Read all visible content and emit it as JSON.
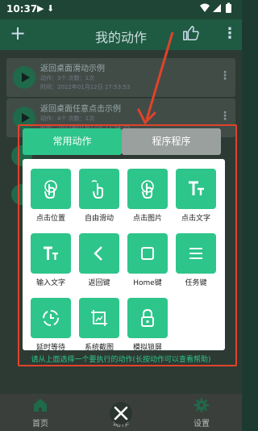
{
  "status_bar": {
    "time": "10:37",
    "notif_icons": "▶ ⬇"
  },
  "appbar": {
    "title": "我的动作"
  },
  "list": [
    {
      "title": "返回桌面滑动示例",
      "info": "动作：3个  次数：1次",
      "time": "时间：2022年01月12日 17:53:53"
    },
    {
      "title": "返回桌面任意点击示例",
      "info": "动作：4个  次数：1次",
      "time": "时间：2022年01月12日 17:54:25"
    }
  ],
  "popup": {
    "tabs": [
      {
        "label": "常用动作",
        "active": true
      },
      {
        "label": "程序程序",
        "active": false
      }
    ],
    "items": [
      {
        "label": "点击位置",
        "icon": "tap-finger-icon"
      },
      {
        "label": "自由滑动",
        "icon": "swipe-finger-icon"
      },
      {
        "label": "点击图片",
        "icon": "tap-image-icon"
      },
      {
        "label": "点击文字",
        "icon": "text-t-icon"
      },
      {
        "label": "输入文字",
        "icon": "input-text-icon"
      },
      {
        "label": "返回键",
        "icon": "back-chevron-icon"
      },
      {
        "label": "Home键",
        "icon": "home-square-icon"
      },
      {
        "label": "任务键",
        "icon": "menu-lines-icon"
      },
      {
        "label": "延时等待",
        "icon": "timer-icon"
      },
      {
        "label": "系统截图",
        "icon": "screenshot-icon"
      },
      {
        "label": "模拟锁屏",
        "icon": "lock-icon"
      }
    ],
    "hint": "请从上面选择一个要执行的动作(长按动作可以查看帮助)"
  },
  "nav": {
    "items": [
      {
        "label": "首页",
        "icon": "home-icon"
      },
      {
        "label": "动作",
        "icon": "close-icon"
      },
      {
        "label": "设置",
        "icon": "gear-icon"
      }
    ]
  },
  "colors": {
    "accent": "#2ec58a",
    "highlight": "#e0432b",
    "appbar": "#1f5a42"
  }
}
